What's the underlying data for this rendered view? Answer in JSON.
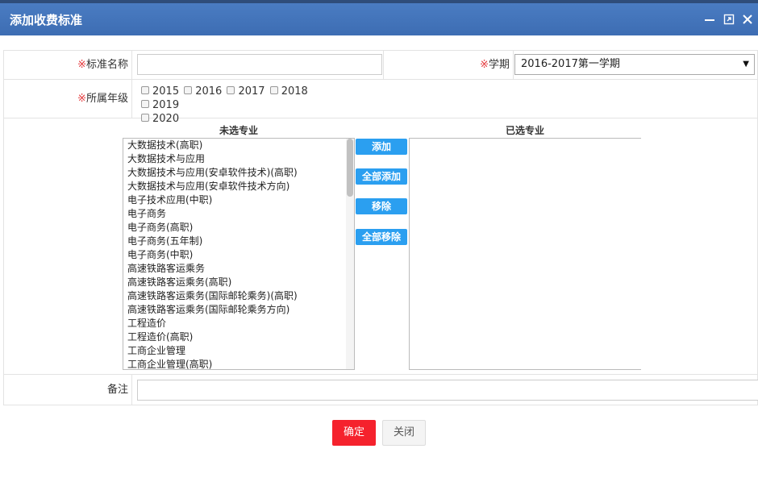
{
  "dialog": {
    "title": "添加收费标准"
  },
  "form": {
    "name_label": "标准名称",
    "term_label": "学期",
    "required_mark": "※",
    "term_value": "2016-2017第一学期",
    "grade_label": "所属年级",
    "years": [
      "2015",
      "2016",
      "2017",
      "2018",
      "2019",
      "2020"
    ],
    "unselected_title": "未选专业",
    "selected_title": "已选专业",
    "unselected_majors": [
      "大数据技术(高职)",
      "大数据技术与应用",
      "大数据技术与应用(安卓软件技术)(高职)",
      "大数据技术与应用(安卓软件技术方向)",
      "电子技术应用(中职)",
      "电子商务",
      "电子商务(高职)",
      "电子商务(五年制)",
      "电子商务(中职)",
      "高速铁路客运乘务",
      "高速铁路客运乘务(高职)",
      "高速铁路客运乘务(国际邮轮乘务)(高职)",
      "高速铁路客运乘务(国际邮轮乘务方向)",
      "工程造价",
      "工程造价(高职)",
      "工商企业管理",
      "工商企业管理(高职)"
    ],
    "btn_add": "添加",
    "btn_add_all": "全部添加",
    "btn_remove": "移除",
    "btn_remove_all": "全部移除",
    "remark_label": "备注"
  },
  "footer": {
    "confirm": "确定",
    "close": "关闭"
  }
}
